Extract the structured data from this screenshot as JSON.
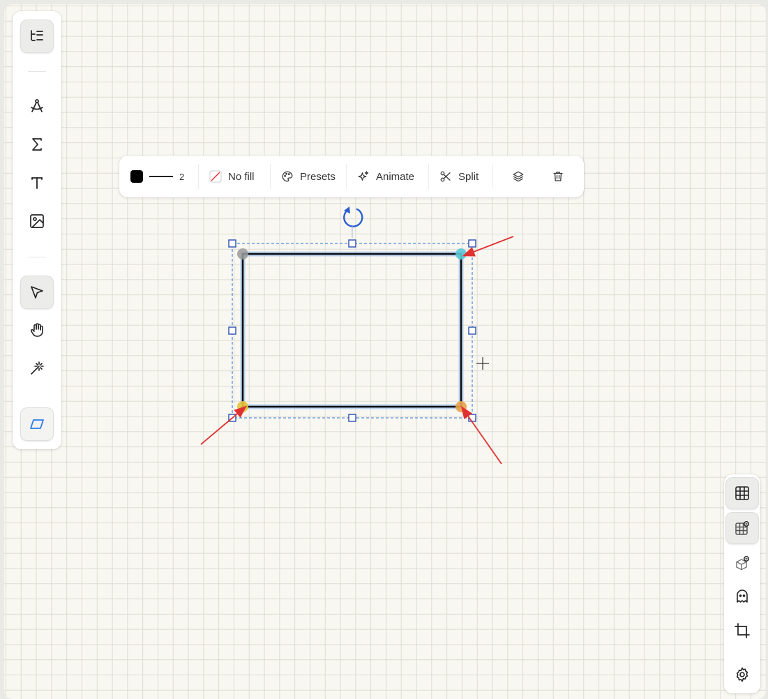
{
  "left_toolbar": {
    "tools": [
      {
        "name": "outline-icon",
        "active": true
      },
      {
        "name": "compass-icon",
        "active": false
      },
      {
        "name": "sigma-icon",
        "active": false
      },
      {
        "name": "text-icon",
        "active": false
      },
      {
        "name": "image-icon",
        "active": false
      },
      {
        "name": "pointer-icon",
        "active": true
      },
      {
        "name": "hand-icon",
        "active": false
      },
      {
        "name": "magic-wand-icon",
        "active": false
      },
      {
        "name": "parallelogram-icon",
        "active": false
      }
    ],
    "accent": "#2b7ce9"
  },
  "shape_toolbar": {
    "stroke_color": "#000000",
    "stroke_width": "2",
    "fill_label": "No fill",
    "presets_label": "Presets",
    "animate_label": "Animate",
    "split_label": "Split"
  },
  "right_toolbar": {
    "tools": [
      "grid-icon",
      "grid-snap-icon",
      "cube-snap-icon",
      "ghost-icon",
      "crop-icon",
      "settings-icon"
    ]
  },
  "canvas": {
    "background": "#f8f7f1",
    "grid_color": "#dddcd2",
    "selection_color": "#2b5fd0",
    "annotation_arrow_color": "#e03131",
    "vertex_colors": {
      "top_left": "#9a9a9a",
      "top_right": "#5bc8d6",
      "bottom_left": "#e6c23a",
      "bottom_right": "#eaa14a"
    }
  }
}
